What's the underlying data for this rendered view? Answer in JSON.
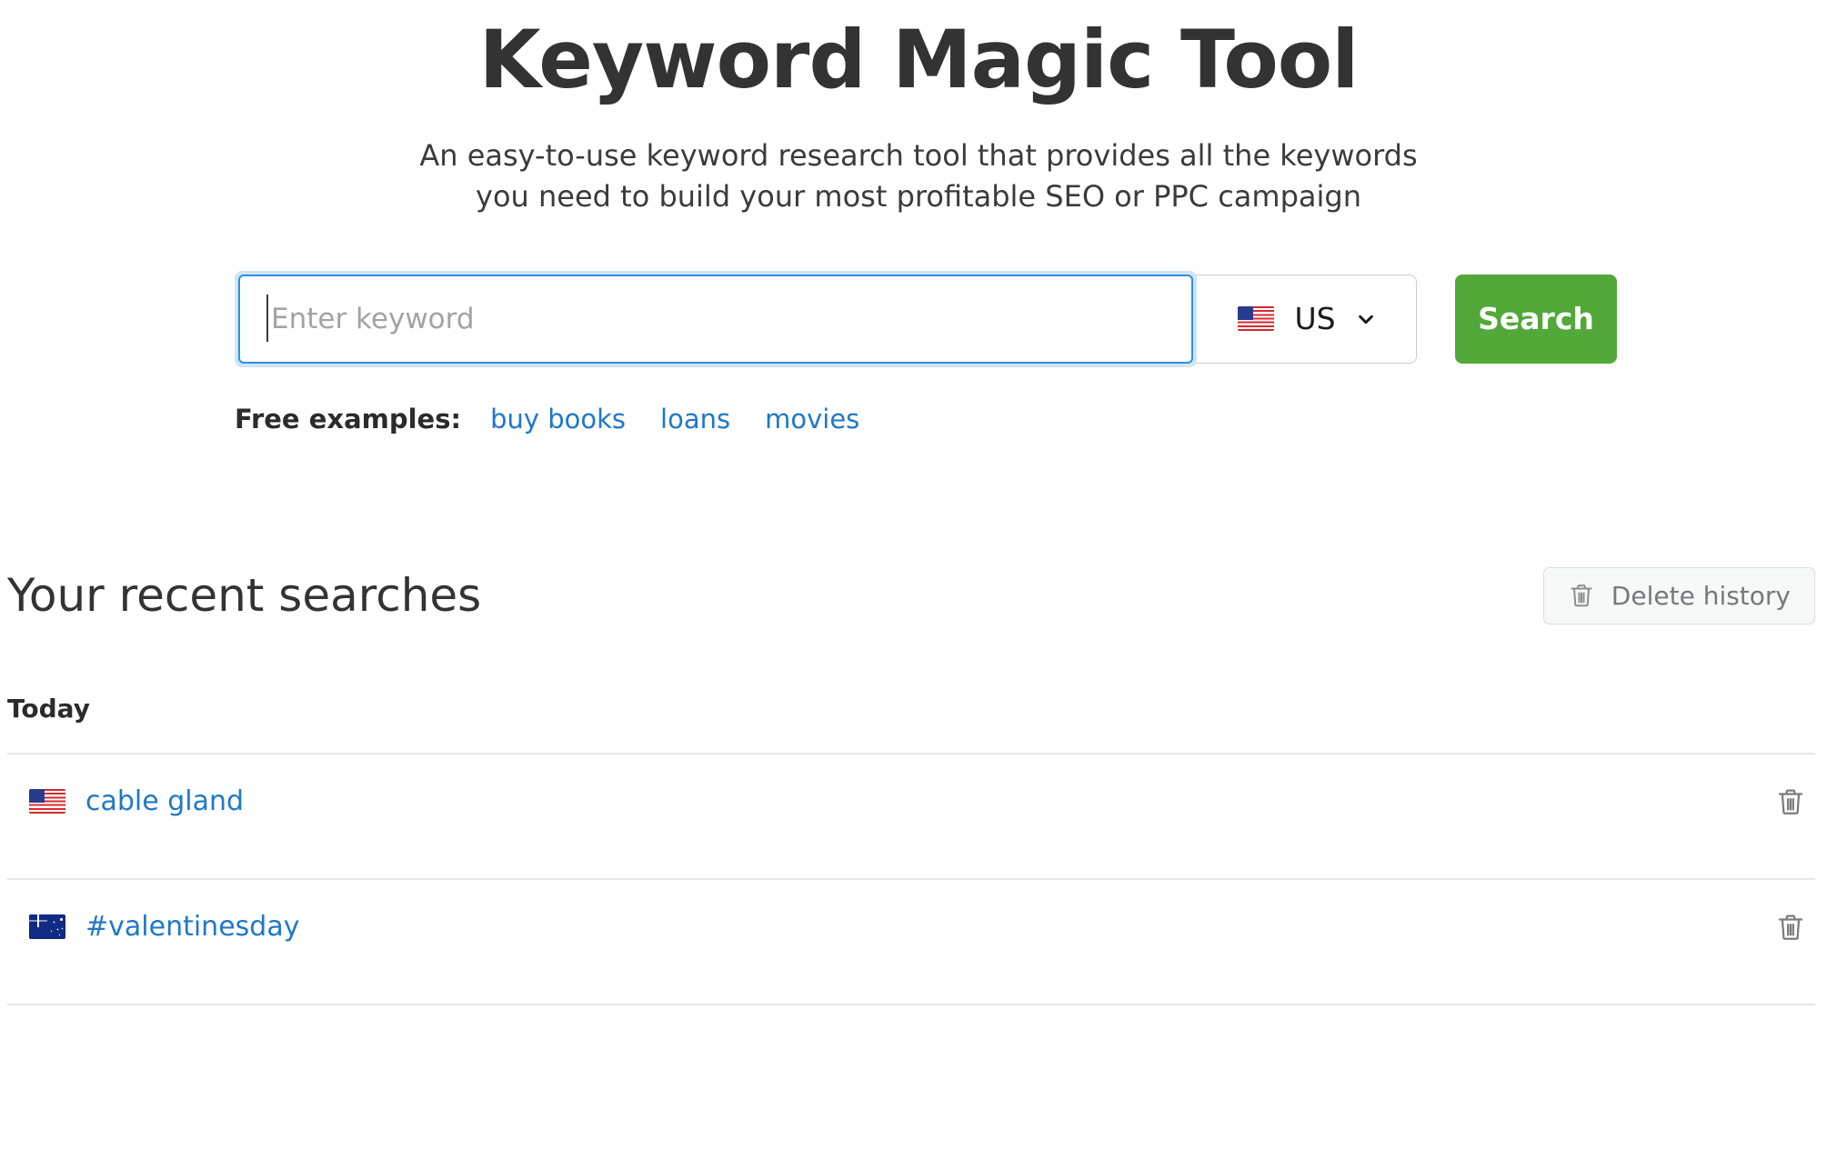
{
  "hero": {
    "title": "Keyword Magic Tool",
    "subtitle": "An easy-to-use keyword research tool that provides all the keywords you need to build your most profitable SEO or PPC campaign"
  },
  "search": {
    "placeholder": "Enter keyword",
    "value": "",
    "country_code": "US",
    "country_flag_icon": "flag-us-icon",
    "dropdown_icon": "chevron-down-icon",
    "button_label": "Search",
    "button_color": "#52a838",
    "focus_border_color": "#2f90e0",
    "focus_glow_color": "#cfe6f8"
  },
  "examples": {
    "label": "Free examples:",
    "links": [
      "buy books",
      "loans",
      "movies"
    ],
    "link_color": "#1f78c8"
  },
  "recent": {
    "title": "Your recent searches",
    "delete_history_label": "Delete history",
    "delete_history_icon": "trash-icon",
    "group_label": "Today",
    "rows": [
      {
        "term": "cable gland",
        "flag": "flag-us-icon",
        "country": "US",
        "delete_icon": "trash-icon"
      },
      {
        "term": "#valentinesday",
        "flag": "flag-au-icon",
        "country": "AU",
        "delete_icon": "trash-icon"
      }
    ]
  }
}
